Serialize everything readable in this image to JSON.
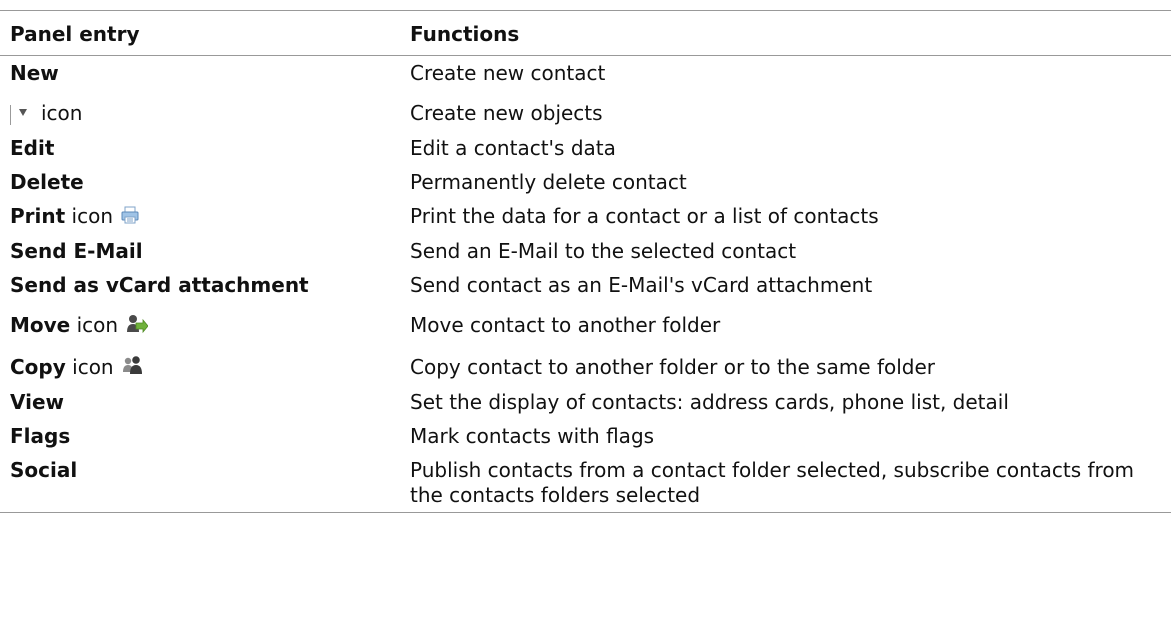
{
  "table": {
    "headers": {
      "col1": "Panel entry",
      "col2": "Functions"
    },
    "rows": [
      {
        "entry": "New",
        "desc": "Create new contact"
      },
      {
        "entry": "icon",
        "desc": "Create new objects",
        "icon": "separator-dropdown-triangle-icon"
      },
      {
        "entry": "Edit",
        "desc": "Edit a contact's data"
      },
      {
        "entry": "Delete",
        "desc": "Permanently delete contact"
      },
      {
        "entry": "Print",
        "suffix": "icon",
        "desc": "Print the data for a contact or a list of contacts",
        "icon": "printer-icon"
      },
      {
        "entry": "Send E-Mail",
        "desc": "Send an E-Mail to the selected contact"
      },
      {
        "entry": "Send as vCard attachment",
        "desc": "Send contact as an E-Mail's vCard attachment"
      },
      {
        "entry": "Move",
        "suffix": "icon",
        "desc": "Move contact to another folder",
        "icon": "move-contact-icon"
      },
      {
        "entry": "Copy",
        "suffix": "icon",
        "desc": "Copy contact to another folder or to the same folder",
        "icon": "copy-contact-icon"
      },
      {
        "entry": "View",
        "desc": "Set the display of contacts: address cards, phone list, detail"
      },
      {
        "entry": "Flags",
        "desc": "Mark contacts with flags"
      },
      {
        "entry": "Social",
        "desc": "Publish contacts from a contact folder selected, subscribe contacts from the contacts folders selected"
      }
    ]
  }
}
